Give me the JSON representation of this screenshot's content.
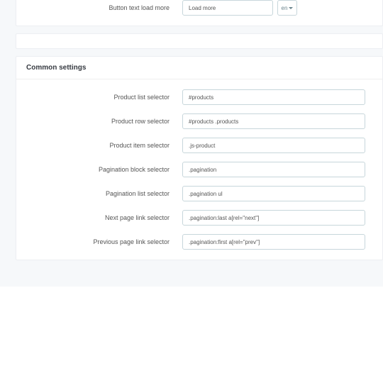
{
  "top": {
    "button_text_label": "Button text load more",
    "button_text_value": "Load more",
    "lang": "en"
  },
  "common": {
    "heading": "Common settings",
    "rows": [
      {
        "label": "Product list selector",
        "value": "#products"
      },
      {
        "label": "Product row selector",
        "value": "#products .products"
      },
      {
        "label": "Product item selector",
        "value": ".js-product"
      },
      {
        "label": "Pagination block selector",
        "value": ".pagination"
      },
      {
        "label": "Pagination list selector",
        "value": ".pagination ul"
      },
      {
        "label": "Next page link selector",
        "value": ".pagination:last a[rel=\"next\"]"
      },
      {
        "label": "Previous page link selector",
        "value": ".pagination:first a[rel=\"prev\"]"
      }
    ]
  }
}
